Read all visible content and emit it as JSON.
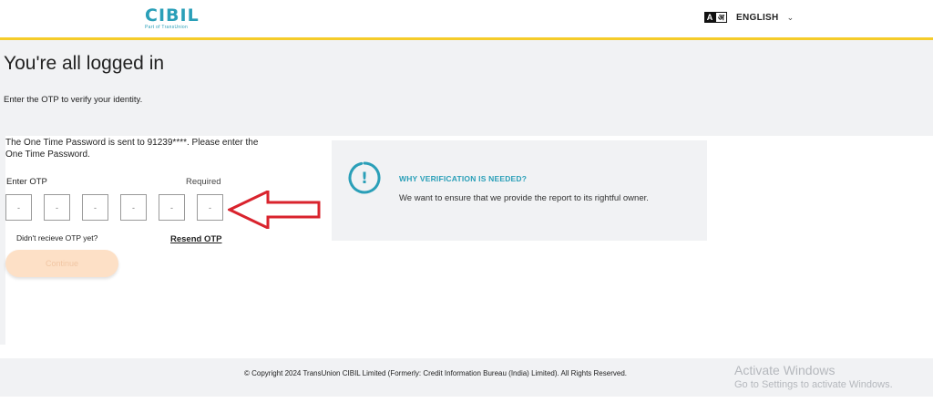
{
  "header": {
    "logo": "CIBIL",
    "logo_sub": "Part of TransUnion",
    "lang_icon_a": "A",
    "lang_icon_h": "अ",
    "language": "ENGLISH",
    "language_chevron": "⌄"
  },
  "page": {
    "title": "You're all logged in",
    "subtitle": "Enter the OTP to verify your identity."
  },
  "otp": {
    "message": "The One Time Password is sent to 91239****. Please enter the One Time Password.",
    "label": "Enter OTP",
    "required": "Required",
    "box_placeholder": "-",
    "didnt_receive": "Didn't recieve OTP yet?",
    "resend": "Resend OTP",
    "continue": "Continue"
  },
  "info": {
    "title": "WHY VERIFICATION IS NEEDED?",
    "text": "We want to ensure that we provide the report to its rightful owner.",
    "icon_mark": "!"
  },
  "footer": {
    "copyright": "© Copyright 2024 TransUnion CIBIL Limited (Formerly: Credit Information Bureau (India) Limited). All Rights Reserved."
  },
  "watermark": {
    "title": "Activate Windows",
    "subtitle": "Go to Settings to activate Windows."
  },
  "colors": {
    "accent": "#2a9fb8",
    "header_border": "#f5cc2a",
    "arrow": "#d9232d",
    "continue_bg": "#fde0c6"
  }
}
